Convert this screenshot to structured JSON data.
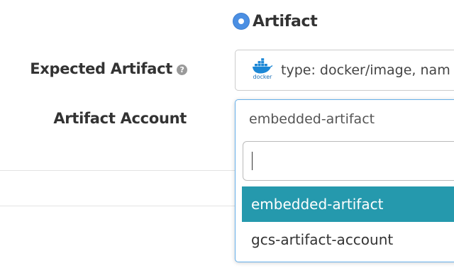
{
  "radio": {
    "label": "Artifact",
    "selected": true,
    "color": "#4b8fe3"
  },
  "expected_artifact": {
    "label": "Expected Artifact",
    "help_icon": "question-circle-icon",
    "icon": "docker-logo-icon",
    "icon_text": "docker",
    "value": "type: docker/image, nam"
  },
  "artifact_account": {
    "label": "Artifact Account",
    "current_value": "embedded-artifact",
    "search_value": "",
    "options": [
      {
        "label": "embedded-artifact",
        "highlighted": true
      },
      {
        "label": "gcs-artifact-account",
        "highlighted": false
      }
    ],
    "highlight_color": "#2599ad"
  }
}
